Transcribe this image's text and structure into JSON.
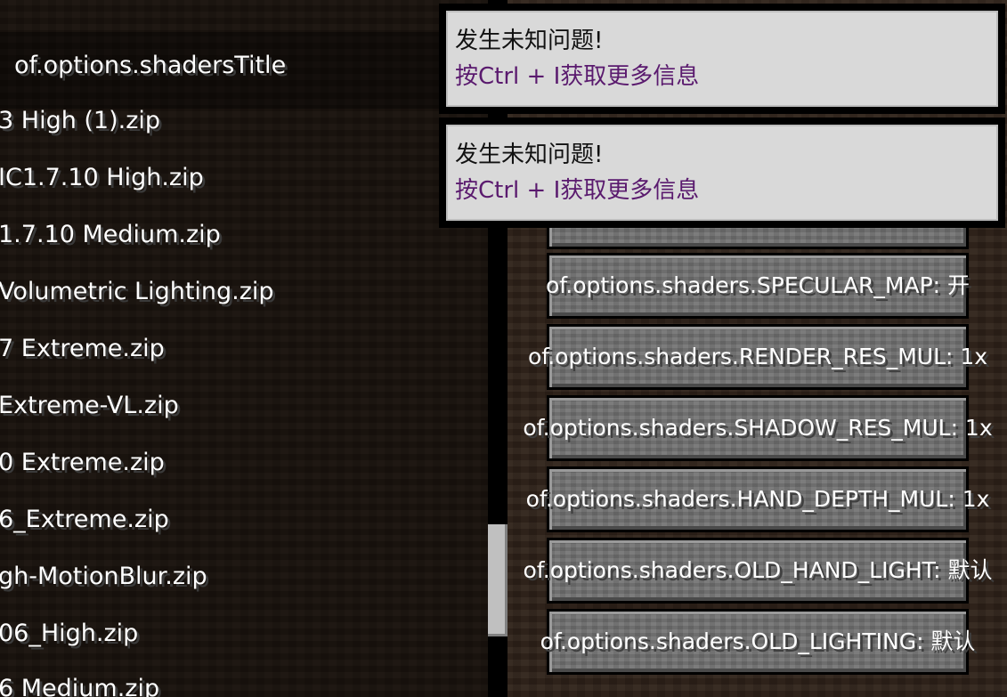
{
  "screen_title": "of.options.shadersTitle",
  "shader_list": [
    "3 High (1).zip",
    "IC1.7.10 High.zip",
    "1.7.10 Medium.zip",
    "Volumetric Lighting.zip",
    "7 Extreme.zip",
    "Extreme-VL.zip",
    "0 Extreme.zip",
    "6_Extreme.zip",
    "gh-MotionBlur.zip",
    "06_High.zip",
    "6 Medium.zip"
  ],
  "options": [
    "of.options.shaders.SPECULAR_MAP: 开",
    "of.options.shaders.RENDER_RES_MUL: 1x",
    "of.options.shaders.SHADOW_RES_MUL: 1x",
    "of.options.shaders.HAND_DEPTH_MUL: 1x",
    "of.options.shaders.OLD_HAND_LIGHT: 默认",
    "of.options.shaders.OLD_LIGHTING: 默认"
  ],
  "toasts": [
    {
      "line1": "发生未知问题!",
      "line2": "按Ctrl + I获取更多信息"
    },
    {
      "line1": "发生未知问题!",
      "line2": "按Ctrl + I获取更多信息"
    }
  ],
  "colors": {
    "toast_background": "#d9d9d9",
    "toast_link_text": "#5a1a6e",
    "button_gray": "#6f6f6f"
  },
  "list_scroll_fraction": 0.8
}
